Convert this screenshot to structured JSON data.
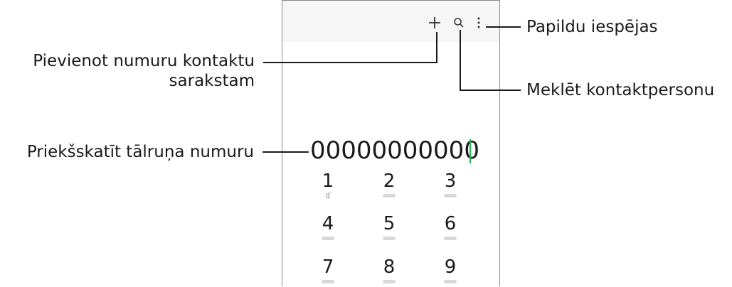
{
  "dialer": {
    "number": "00000000000",
    "icons": {
      "add": "plus-icon",
      "search": "search-icon",
      "more": "more-options-icon",
      "voicemail": "voicemail-icon"
    },
    "keys": [
      {
        "digit": "1",
        "sub": "voicemail"
      },
      {
        "digit": "2",
        "sub": ""
      },
      {
        "digit": "3",
        "sub": ""
      },
      {
        "digit": "4",
        "sub": ""
      },
      {
        "digit": "5",
        "sub": ""
      },
      {
        "digit": "6",
        "sub": ""
      },
      {
        "digit": "7",
        "sub": ""
      },
      {
        "digit": "8",
        "sub": ""
      },
      {
        "digit": "9",
        "sub": ""
      }
    ],
    "cursor_color": "#1db954"
  },
  "callouts": {
    "more_options": "Papildu iespējas",
    "add_contact_line1": "Pievienot numuru kontaktu",
    "add_contact_line2": "sarakstam",
    "search_contact": "Meklēt kontaktpersonu",
    "preview_number": "Priekšskatīt tālruņa numuru"
  }
}
